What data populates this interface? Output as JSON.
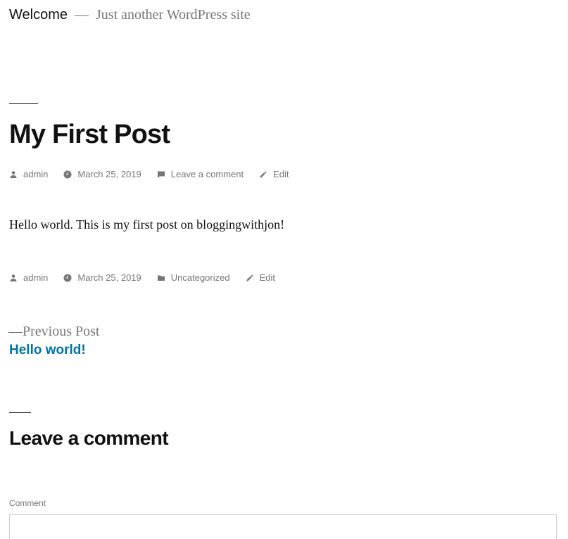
{
  "header": {
    "site_title": "Welcome",
    "separator": "—",
    "description": "Just another WordPress site"
  },
  "post": {
    "title": "My First Post",
    "meta_top": {
      "author": "admin",
      "date": "March 25, 2019",
      "comment_link": "Leave a comment",
      "edit": "Edit"
    },
    "body": "Hello world. This is my first post on bloggingwithjon!",
    "meta_bottom": {
      "author": "admin",
      "date": "March 25, 2019",
      "category": "Uncategorized",
      "edit": "Edit"
    }
  },
  "navigation": {
    "previous_label": "—Previous Post",
    "previous_title": "Hello world!"
  },
  "comments": {
    "title": "Leave a comment",
    "comment_label": "Comment",
    "comment_value": ""
  },
  "icons": {
    "author": "person-icon",
    "date": "clock-icon",
    "comment": "comment-bubble-icon",
    "edit": "pencil-icon",
    "category": "folder-icon"
  },
  "colors": {
    "text": "#111111",
    "meta": "#767676",
    "link": "#0073aa",
    "border": "#cccccc"
  }
}
